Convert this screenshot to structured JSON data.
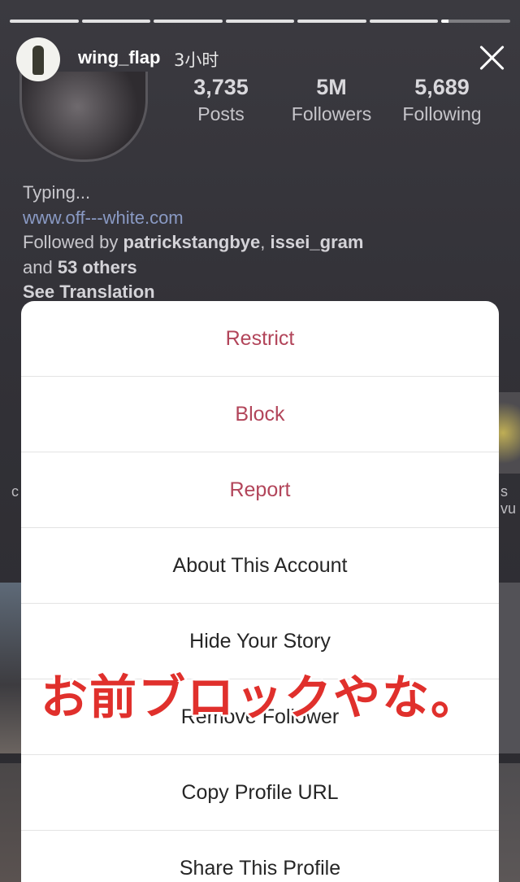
{
  "story": {
    "progress_segments": [
      1,
      1,
      1,
      1,
      1,
      1,
      0.1
    ],
    "username": "wing_flap",
    "time": "3小时"
  },
  "profile": {
    "stats": [
      {
        "value": "3,735",
        "label": "Posts"
      },
      {
        "value": "5M",
        "label": "Followers"
      },
      {
        "value": "5,689",
        "label": "Following"
      }
    ],
    "bio": {
      "line1": "Typing...",
      "link": "www.off---white.com",
      "followed_prefix": "Followed by ",
      "followed_user1": "patrickstangbye",
      "followed_sep": ", ",
      "followed_user2": "issei_gram",
      "followed_and": "and ",
      "followed_others": "53 others",
      "see_translation": "See Translation"
    },
    "side_left_text": "c",
    "side_right_text": "s vu"
  },
  "menu": {
    "items": [
      {
        "label": "Restrict",
        "style": "danger"
      },
      {
        "label": "Block",
        "style": "danger"
      },
      {
        "label": "Report",
        "style": "danger"
      },
      {
        "label": "About This Account",
        "style": "normal"
      },
      {
        "label": "Hide Your Story",
        "style": "normal"
      },
      {
        "label": "Remove Follower",
        "style": "normal"
      },
      {
        "label": "Copy Profile URL",
        "style": "normal"
      },
      {
        "label": "Share This Profile",
        "style": "normal"
      }
    ]
  },
  "overlay": {
    "caption": "お前ブロックやな。"
  },
  "colors": {
    "danger": "#b2455a",
    "caption": "#e0302c"
  }
}
